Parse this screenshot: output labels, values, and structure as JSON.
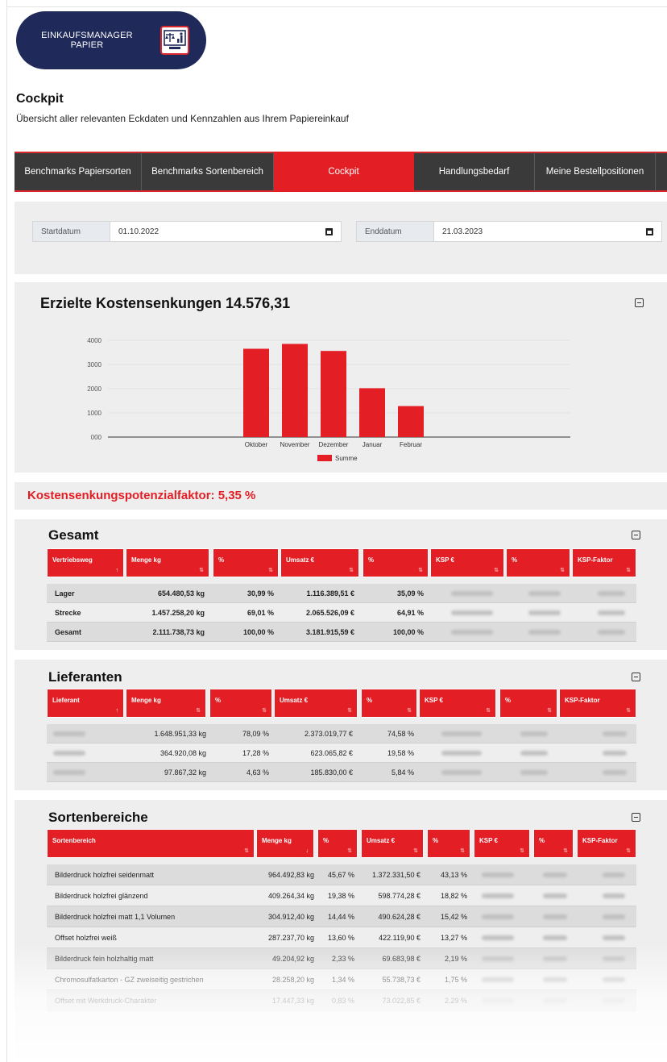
{
  "logo": {
    "line1": "EINKAUFSMANAGER",
    "line2": "PAPIER",
    "badge_icon": "scale-chart-icon"
  },
  "page": {
    "title": "Cockpit",
    "subtitle": "Übersicht aller relevanten Eckdaten und Kennzahlen aus Ihrem Papiereinkauf"
  },
  "tabs": [
    {
      "label": "Benchmarks Papiersorten",
      "active": false
    },
    {
      "label": "Benchmarks Sortenbereich",
      "active": false
    },
    {
      "label": "Cockpit",
      "active": true
    },
    {
      "label": "Handlungsbedarf",
      "active": false
    },
    {
      "label": "Meine Bestellpositionen",
      "active": false
    },
    {
      "label": "",
      "active": false
    }
  ],
  "dates": {
    "start_label": "Startdatum",
    "start_value": "01.10.2022",
    "end_label": "Enddatum",
    "end_value": "21.03.2023"
  },
  "chart_title": "Erzielte Kostensenkungen 14.576,31",
  "chart_data": {
    "type": "bar",
    "categories": [
      "Oktober",
      "November",
      "Dezember",
      "Januar",
      "Februar"
    ],
    "series": [
      {
        "name": "Summe",
        "values": [
          3650,
          3850,
          3560,
          2020,
          1280
        ],
        "color": "#e31e24"
      }
    ],
    "yticks": [
      "4000",
      "3000",
      "2000",
      "1000",
      "000"
    ],
    "ylim": [
      0,
      4000
    ],
    "grid": true,
    "legend": "bottom"
  },
  "ksp_factor": "Kostensenkungspotenzialfaktor: 5,35 %",
  "gesamt": {
    "title": "Gesamt",
    "headers": [
      "Vertriebsweg",
      "Menge kg",
      "%",
      "Umsatz €",
      "%",
      "KSP €",
      "%",
      "KSP-Faktor"
    ],
    "rows": [
      [
        "Lager",
        "654.480,53 kg",
        "30,99 %",
        "1.116.389,51 €",
        "35,09 %"
      ],
      [
        "Strecke",
        "1.457.258,20 kg",
        "69,01 %",
        "2.065.526,09 €",
        "64,91 %"
      ],
      [
        "Gesamt",
        "2.111.738,73 kg",
        "100,00 %",
        "3.181.915,59 €",
        "100,00 %"
      ]
    ]
  },
  "lieferanten": {
    "title": "Lieferanten",
    "headers": [
      "Lieferant",
      "Menge kg",
      "%",
      "Umsatz €",
      "%",
      "KSP €",
      "%",
      "KSP-Faktor"
    ],
    "rows": [
      [
        "1.648.951,33 kg",
        "78,09 %",
        "2.373.019,77 €",
        "74,58 %"
      ],
      [
        "364.920,08 kg",
        "17,28 %",
        "623.065,82 €",
        "19,58 %"
      ],
      [
        "97.867,32 kg",
        "4,63 %",
        "185.830,00 €",
        "5,84 %"
      ]
    ]
  },
  "sorten": {
    "title": "Sortenbereiche",
    "headers": [
      "Sortenbereich",
      "Menge kg",
      "%",
      "Umsatz €",
      "%",
      "KSP €",
      "%",
      "KSP-Faktor"
    ],
    "rows": [
      [
        "Bilderdruck holzfrei seidenmatt",
        "964.492,83 kg",
        "45,67 %",
        "1.372.331,50 €",
        "43,13 %"
      ],
      [
        "Bilderdruck holzfrei glänzend",
        "409.264,34 kg",
        "19,38 %",
        "598.774,28 €",
        "18,82 %"
      ],
      [
        "Bilderdruck holzfrei matt 1,1 Volumen",
        "304.912,40 kg",
        "14,44 %",
        "490.624,28 €",
        "15,42 %"
      ],
      [
        "Offset holzfrei weiß",
        "287.237,70 kg",
        "13,60 %",
        "422.119,90 €",
        "13,27 %"
      ],
      [
        "Bilderdruck fein holzhaltig matt",
        "49.204,92 kg",
        "2,33 %",
        "69.683,98 €",
        "2,19 %"
      ],
      [
        "Chromosulfatkarton - GZ zweiseitig gestrichen",
        "28.258,20 kg",
        "1,34 %",
        "55.738,73 €",
        "1,75 %"
      ],
      [
        "Offset mit Werkdruck-Charakter",
        "17.447,33 kg",
        "0,83 %",
        "73.022,85 €",
        "2,29 %"
      ]
    ]
  }
}
